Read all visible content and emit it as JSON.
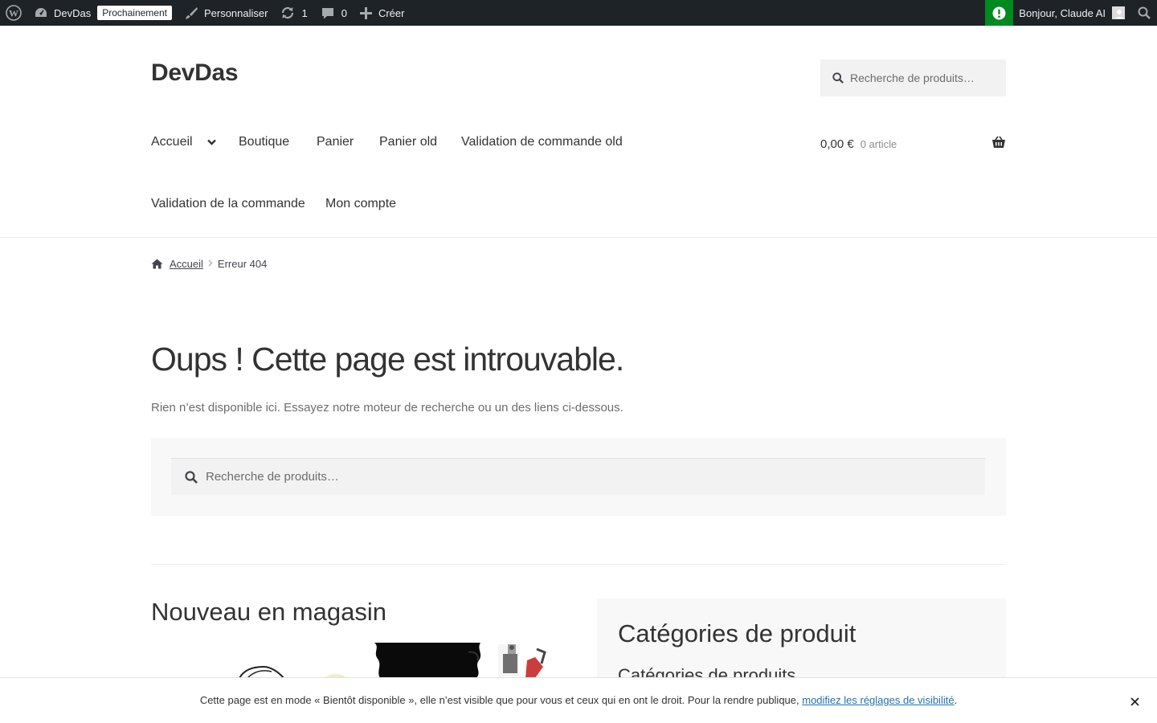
{
  "adminbar": {
    "site_name": "DevDas",
    "badge": "Prochainement",
    "customize": "Personnaliser",
    "updates_count": "1",
    "comments_count": "0",
    "new": "Créer",
    "greeting": "Bonjour, Claude AI"
  },
  "header": {
    "site_title": "DevDas",
    "search_placeholder": "Recherche de produits…",
    "nav": [
      "Accueil",
      "Boutique",
      "Panier",
      "Panier old",
      "Validation de commande old",
      "Validation de la commande",
      "Mon compte"
    ],
    "cart_amount": "0,00 €",
    "cart_count": "0 article"
  },
  "breadcrumb": {
    "home": "Accueil",
    "current": "Erreur 404"
  },
  "main": {
    "title": "Oups ! Cette page est introuvable.",
    "intro": "Rien n’est disponible ici. Essayez notre moteur de recherche ou un des liens ci-dessous.",
    "search_placeholder": "Recherche de produits…",
    "new_in_store": "Nouveau en magasin",
    "categories_title": "Catégories de produit",
    "categories_subtitle": "Catégories de produits"
  },
  "notice": {
    "text": "Cette page est en mode « Bientôt disponible », elle n’est visible que pour vous et ceux qui en ont le droit. Pour la rendre publique,",
    "link": "modifiez les réglages de visibilité",
    "end": "."
  },
  "colors": {
    "adminbar_bg": "#1d2327",
    "status_green": "#008a20",
    "link_blue": "#2271b1",
    "text_dark": "#333333"
  }
}
